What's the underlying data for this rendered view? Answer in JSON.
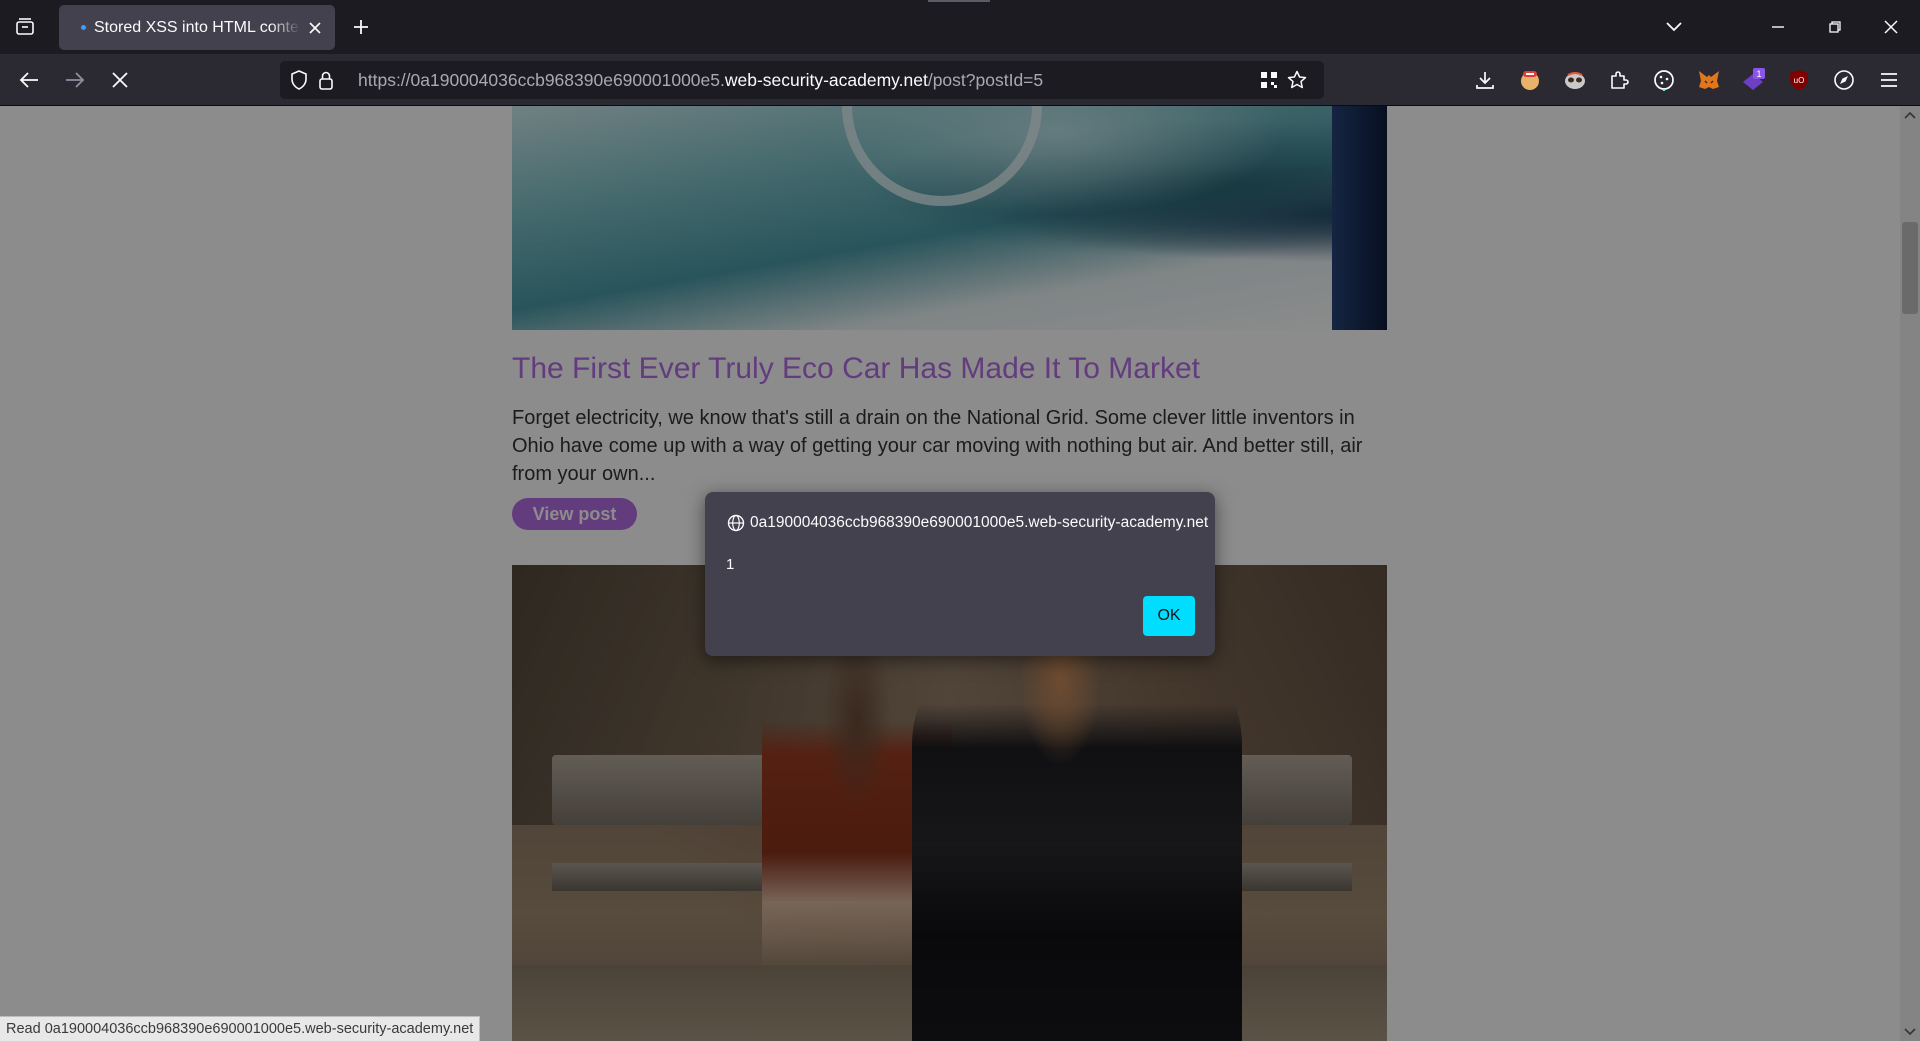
{
  "browser": {
    "tab": {
      "title": "Stored XSS into HTML context with nothing encoded"
    },
    "url": {
      "prefix": "https://0a190004036ccb968390e690001000e5.",
      "host": "web-security-academy.net",
      "path": "/post?postId=5"
    },
    "icons": {
      "list_tabs": "list-all-tabs-icon",
      "new_tab": "plus-icon",
      "back": "arrow-left-icon",
      "forward": "arrow-right-icon",
      "stop": "x-icon",
      "tracking": "shield-icon",
      "lock": "lock-icon",
      "qr": "qr-code-icon",
      "bookmark": "star-icon"
    },
    "extensions": [
      {
        "name": "downloads-icon"
      },
      {
        "name": "adblock-extension-icon"
      },
      {
        "name": "privacy-badger-extension-icon"
      },
      {
        "name": "extensions-puzzle-icon"
      },
      {
        "name": "cookie-editor-extension-icon"
      },
      {
        "name": "metamask-extension-icon"
      },
      {
        "name": "notification-extension-icon",
        "badge": "1"
      },
      {
        "name": "ublock-origin-extension-icon",
        "label": "uO"
      },
      {
        "name": "compass-extension-icon"
      },
      {
        "name": "menu-icon"
      }
    ]
  },
  "page": {
    "post": {
      "title": "The First Ever Truly Eco Car Has Made It To Market",
      "summary": "Forget electricity, we know that's still a drain on the National Grid. Some clever little inventors in Ohio have come up with a way of getting your car moving with nothing but air. And better still, air from your own...",
      "button": "View post"
    },
    "colors": {
      "accent": "#b46ee6",
      "text": "#333332"
    }
  },
  "dialog": {
    "origin": "0a190004036ccb968390e690001000e5.web-security-academy.net",
    "message": "1",
    "ok_label": "OK",
    "accent": "#00ddff"
  },
  "status": {
    "text": "Read 0a190004036ccb968390e690001000e5.web-security-academy.net"
  }
}
